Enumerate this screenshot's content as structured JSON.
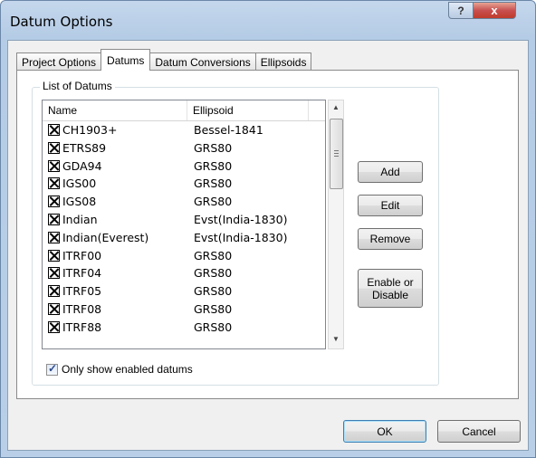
{
  "window": {
    "title": "Datum Options",
    "help_label": "?",
    "close_label": "x"
  },
  "tabs": [
    {
      "label": "Project Options"
    },
    {
      "label": "Datums"
    },
    {
      "label": "Datum Conversions"
    },
    {
      "label": "Ellipsoids"
    }
  ],
  "group": {
    "label": "List of Datums"
  },
  "list": {
    "columns": [
      "Name",
      "Ellipsoid"
    ],
    "rows": [
      {
        "name": "CH1903+",
        "ellipsoid": "Bessel-1841",
        "enabled": true
      },
      {
        "name": "ETRS89",
        "ellipsoid": "GRS80",
        "enabled": true
      },
      {
        "name": "GDA94",
        "ellipsoid": "GRS80",
        "enabled": true
      },
      {
        "name": "IGS00",
        "ellipsoid": "GRS80",
        "enabled": true
      },
      {
        "name": "IGS08",
        "ellipsoid": "GRS80",
        "enabled": true
      },
      {
        "name": "Indian",
        "ellipsoid": "Evst(India-1830)",
        "enabled": true
      },
      {
        "name": "Indian(Everest)",
        "ellipsoid": "Evst(India-1830)",
        "enabled": true
      },
      {
        "name": "ITRF00",
        "ellipsoid": "GRS80",
        "enabled": true
      },
      {
        "name": "ITRF04",
        "ellipsoid": "GRS80",
        "enabled": true
      },
      {
        "name": "ITRF05",
        "ellipsoid": "GRS80",
        "enabled": true
      },
      {
        "name": "ITRF08",
        "ellipsoid": "GRS80",
        "enabled": true
      },
      {
        "name": "ITRF88",
        "ellipsoid": "GRS80",
        "enabled": true
      }
    ]
  },
  "side_buttons": {
    "add": "Add",
    "edit": "Edit",
    "remove": "Remove",
    "enable_disable_line1": "Enable or",
    "enable_disable_line2": "Disable"
  },
  "only_enabled": {
    "label": "Only show enabled datums",
    "checked": true
  },
  "footer": {
    "ok": "OK",
    "cancel": "Cancel"
  },
  "colors": {
    "title_bar": "#b9d1ea",
    "close_button": "#c75050",
    "panel": "#f0f0f0"
  },
  "icons": [
    "help-icon",
    "close-icon",
    "scroll-up-icon",
    "scroll-down-icon",
    "checkmark-icon"
  ]
}
